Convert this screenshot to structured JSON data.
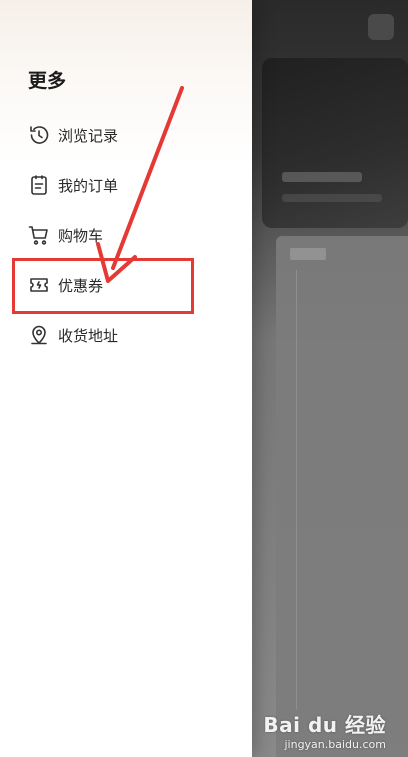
{
  "drawer": {
    "title": "更多",
    "items": [
      {
        "label": "浏览记录",
        "icon": "history-icon"
      },
      {
        "label": "我的订单",
        "icon": "order-list-icon"
      },
      {
        "label": "购物车",
        "icon": "cart-icon"
      },
      {
        "label": "优惠券",
        "icon": "coupon-icon"
      },
      {
        "label": "收货地址",
        "icon": "location-pin-icon"
      }
    ]
  },
  "annotation": {
    "color": "#e53935",
    "highlighted_item": "优惠券"
  },
  "watermark": {
    "brand": "Bai du 经验",
    "url": "jingyan.baidu.com"
  }
}
